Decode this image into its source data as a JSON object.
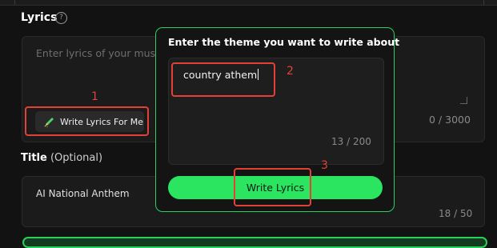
{
  "lyrics": {
    "label": "Lyrics",
    "help_icon": "?",
    "placeholder": "Enter lyrics of your music",
    "counter": "0 / 3000",
    "write_for_me_label": "Write Lyrics For Me"
  },
  "title_section": {
    "label": "Title",
    "optional": "(Optional)",
    "value": "AI National Anthem",
    "counter": "18 / 50"
  },
  "modal": {
    "heading": "Enter the theme you want to write about",
    "theme_value": "country athem",
    "counter": "13 / 200",
    "button_label": "Write Lyrics"
  },
  "annotations": {
    "marker_1": "1",
    "marker_2": "2",
    "marker_3": "3",
    "color": "#e24236"
  },
  "colors": {
    "accent": "#2be460",
    "background": "#121212"
  }
}
